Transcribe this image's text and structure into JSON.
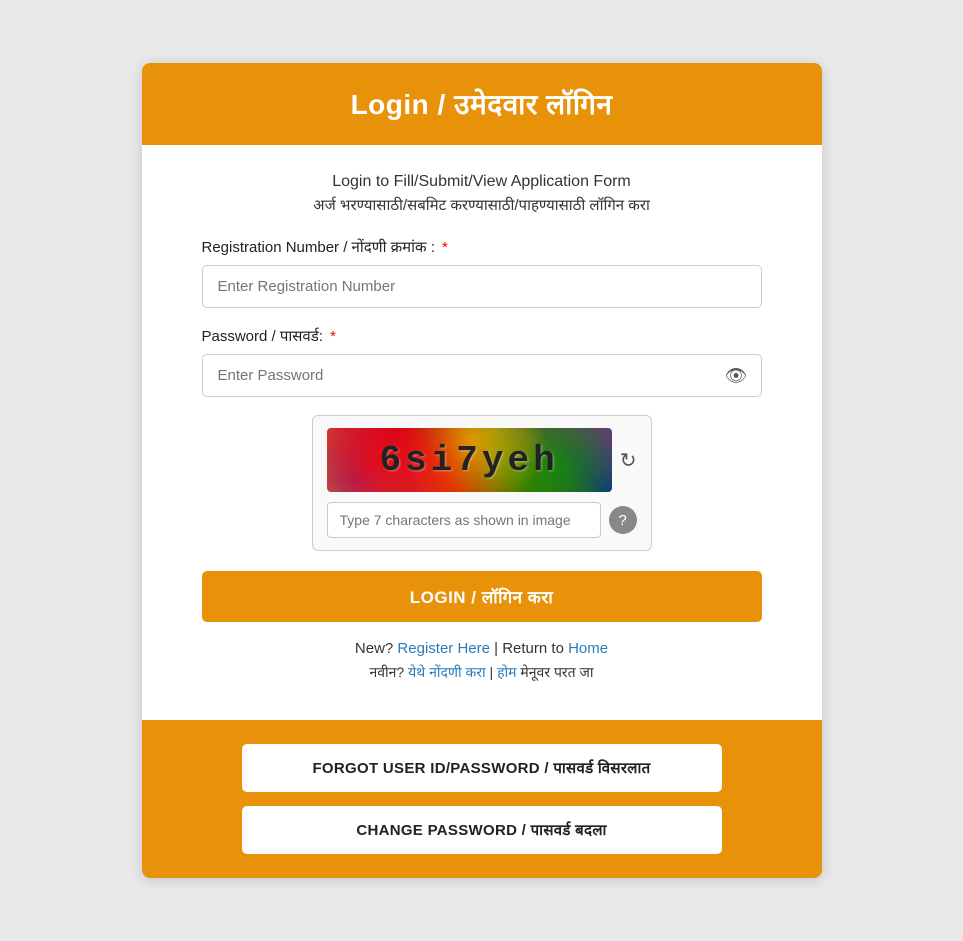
{
  "header": {
    "title": "Login / उमेदवार लॉगिन"
  },
  "subtitle": {
    "english": "Login to Fill/Submit/View Application Form",
    "marathi": "अर्ज भरण्यासाठी/सबमिट करण्यासाठी/पाहण्यासाठी लॉगिन करा"
  },
  "form": {
    "registration_label": "Registration Number / नोंदणी क्रमांक :",
    "registration_required": "*",
    "registration_placeholder": "Enter Registration Number",
    "password_label": "Password / पासवर्ड:",
    "password_required": "*",
    "password_placeholder": "Enter Password"
  },
  "captcha": {
    "text": "6si7yeh",
    "input_placeholder": "Type 7 characters as shown in image",
    "refresh_icon": "↻",
    "help_icon": "?"
  },
  "buttons": {
    "login": "LOGIN / लॉगिन करा",
    "forgot": "FORGOT USER ID/PASSWORD / पासवर्ड विसरलात",
    "change_password": "CHANGE PASSWORD / पासवर्ड बदला"
  },
  "links": {
    "new_label_en": "New?",
    "register_en": "Register Here",
    "separator_en": "|",
    "return_en": "Return to",
    "home_en": "Home",
    "new_label_mr": "नवीन?",
    "register_mr": "येथे नोंदणी करा",
    "separator_mr": "|",
    "home_mr": "होम",
    "return_mr": "मेनूवर परत जा"
  }
}
